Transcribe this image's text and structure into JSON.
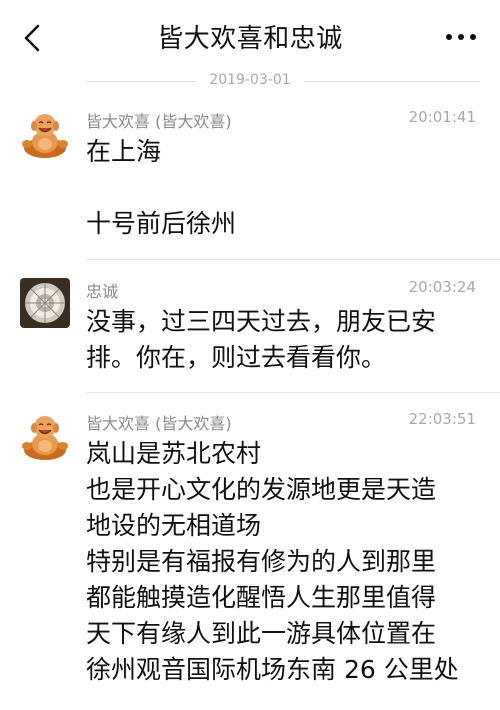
{
  "header": {
    "title": "皆大欢喜和忠诚",
    "back_icon": "chevron-left-icon",
    "more_icon": "more-dots-icon"
  },
  "date_separator": "2019-03-01",
  "messages": [
    {
      "sender": "皆大欢喜 (皆大欢喜)",
      "time": "20:01:41",
      "avatar": "laughing-buddha-avatar",
      "lines": [
        "在上海",
        "",
        "十号前后徐州"
      ]
    },
    {
      "sender": "忠诚",
      "time": "20:03:24",
      "avatar": "crystal-avatar",
      "lines": [
        "没事，过三四天过去，朋友已安",
        "排。你在，则过去看看你。"
      ]
    },
    {
      "sender": "皆大欢喜 (皆大欢喜)",
      "time": "22:03:51",
      "avatar": "laughing-buddha-avatar",
      "lines": [
        "岚山是苏北农村",
        "也是开心文化的发源地更是天造",
        "地设的无相道场",
        "特别是有福报有修为的人到那里",
        "都能触摸造化醒悟人生那里值得",
        "天下有缘人到此一游具体位置在",
        "徐州观音国际机场东南 26 公里处"
      ]
    }
  ]
}
